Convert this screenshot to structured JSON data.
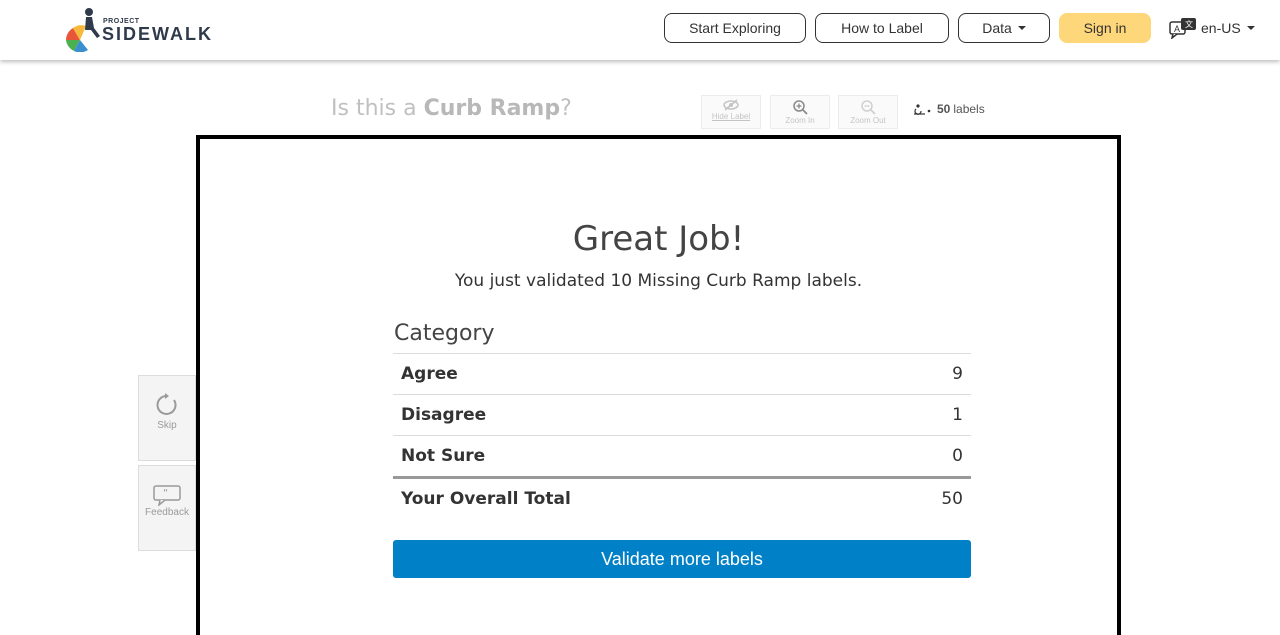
{
  "navbar": {
    "logo_small": "PROJECT",
    "logo_name": "SIDEWALK",
    "start_exploring": "Start Exploring",
    "how_to_label": "How to Label",
    "data": "Data",
    "sign_in": "Sign in",
    "language": "en-US"
  },
  "background": {
    "question_prefix": "Is this a ",
    "question_label": "Curb Ramp",
    "question_suffix": "?",
    "hide_label": "Hide Label",
    "zoom_in": "Zoom In",
    "zoom_out": "Zoom Out",
    "labels_count": "50",
    "labels_word": "labels",
    "skip": "Skip",
    "feedback": "Feedback"
  },
  "modal": {
    "title": "Great Job!",
    "subtitle": "You just validated 10 Missing Curb Ramp labels.",
    "category_header": "Category",
    "rows": [
      {
        "label": "Agree",
        "value": "9"
      },
      {
        "label": "Disagree",
        "value": "1"
      },
      {
        "label": "Not Sure",
        "value": "0"
      }
    ],
    "total_label": "Your Overall Total",
    "total_value": "50",
    "validate_button": "Validate more labels"
  },
  "colors": {
    "primary_button": "#0080c6",
    "sign_in": "#fdd77a"
  }
}
